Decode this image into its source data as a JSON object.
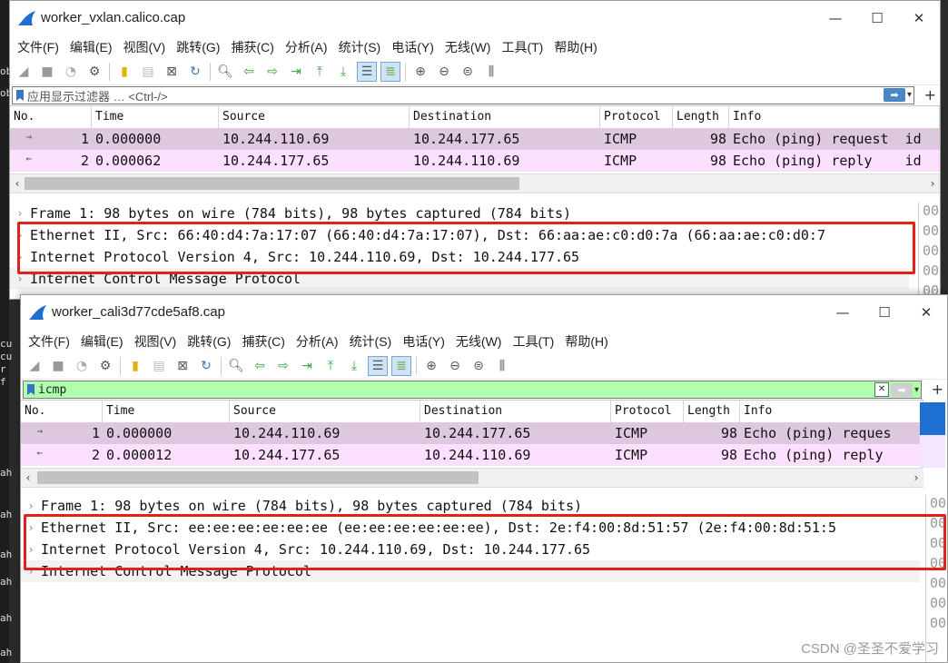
{
  "window1": {
    "title": "worker_vxlan.calico.cap",
    "menu": [
      "文件(F)",
      "编辑(E)",
      "视图(V)",
      "跳转(G)",
      "捕获(C)",
      "分析(A)",
      "统计(S)",
      "电话(Y)",
      "无线(W)",
      "工具(T)",
      "帮助(H)"
    ],
    "filter": {
      "value": "",
      "placeholder": "应用显示过滤器 … <Ctrl-/>"
    },
    "columns": [
      "No.",
      "Time",
      "Source",
      "Destination",
      "Protocol",
      "Length",
      "Info"
    ],
    "packets": [
      {
        "no": "1",
        "time": "0.000000",
        "src": "10.244.110.69",
        "dst": "10.244.177.65",
        "proto": "ICMP",
        "len": "98",
        "info": "Echo (ping) request  id"
      },
      {
        "no": "2",
        "time": "0.000062",
        "src": "10.244.177.65",
        "dst": "10.244.110.69",
        "proto": "ICMP",
        "len": "98",
        "info": "Echo (ping) reply    id"
      }
    ],
    "details": [
      "Frame 1: 98 bytes on wire (784 bits), 98 bytes captured (784 bits)",
      "Ethernet II, Src: 66:40:d4:7a:17:07 (66:40:d4:7a:17:07), Dst: 66:aa:ae:c0:d0:7a (66:aa:ae:c0:d0:7",
      "Internet Protocol Version 4, Src: 10.244.110.69, Dst: 10.244.177.65",
      "Internet Control Message Protocol"
    ],
    "hex": [
      "00",
      "00",
      "00",
      "00",
      "00"
    ]
  },
  "window2": {
    "title": "worker_cali3d77cde5af8.cap",
    "menu": [
      "文件(F)",
      "编辑(E)",
      "视图(V)",
      "跳转(G)",
      "捕获(C)",
      "分析(A)",
      "统计(S)",
      "电话(Y)",
      "无线(W)",
      "工具(T)",
      "帮助(H)"
    ],
    "filter": {
      "value": "icmp"
    },
    "columns": [
      "No.",
      "Time",
      "Source",
      "Destination",
      "Protocol",
      "Length",
      "Info"
    ],
    "packets": [
      {
        "no": "1",
        "time": "0.000000",
        "src": "10.244.110.69",
        "dst": "10.244.177.65",
        "proto": "ICMP",
        "len": "98",
        "info": "Echo (ping) reques"
      },
      {
        "no": "2",
        "time": "0.000012",
        "src": "10.244.177.65",
        "dst": "10.244.110.69",
        "proto": "ICMP",
        "len": "98",
        "info": "Echo (ping) reply"
      }
    ],
    "details": [
      "Frame 1: 98 bytes on wire (784 bits), 98 bytes captured (784 bits)",
      "Ethernet II, Src: ee:ee:ee:ee:ee:ee (ee:ee:ee:ee:ee:ee), Dst: 2e:f4:00:8d:51:57 (2e:f4:00:8d:51:5",
      "Internet Protocol Version 4, Src: 10.244.110.69, Dst: 10.244.177.65",
      "Internet Control Message Protocol"
    ],
    "hex": [
      "00",
      "00",
      "00",
      "00",
      "00",
      "00",
      "00"
    ]
  },
  "background_chars": [
    "ob",
    "ob",
    "cu",
    "cu",
    "r",
    "f",
    "ah",
    "ah",
    "ah",
    "ah",
    "ah",
    "ah"
  ],
  "watermark": "CSDN @圣圣不爱学习",
  "colors": {
    "row_selected": "#dec8e0",
    "row_icmp": "#fce0ff",
    "filter_ok": "#afffaf",
    "highlight_box": "#e0231a"
  }
}
